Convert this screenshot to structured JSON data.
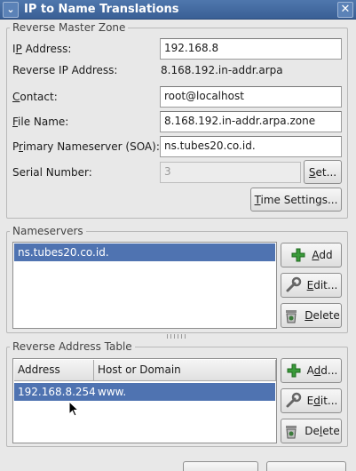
{
  "window": {
    "title": "IP to Name Translations"
  },
  "reverse_master_zone": {
    "group_label": "Reverse Master Zone",
    "ip_address_label_pre": "I",
    "ip_address_label_mnemonic": "P",
    "ip_address_label_post": " Address:",
    "ip_address_value": "192.168.8",
    "reverse_ip_label": "Reverse IP Address:",
    "reverse_ip_value": "8.168.192.in-addr.arpa",
    "contact_label_mnemonic": "C",
    "contact_label_post": "ontact:",
    "contact_value": "root@localhost",
    "filename_label_mnemonic": "F",
    "filename_label_post": "ile Name:",
    "filename_value": "8.168.192.in-addr.arpa.zone",
    "primary_ns_label_pre": "P",
    "primary_ns_label_mnemonic": "r",
    "primary_ns_label_post": "imary Nameserver (SOA):",
    "primary_ns_value": "ns.tubes20.co.id.",
    "serial_label": "Serial Number:",
    "serial_value": "3",
    "set_button_mnemonic": "S",
    "set_button_post": "et...",
    "time_settings_mnemonic": "T",
    "time_settings_post": "ime Settings..."
  },
  "nameservers": {
    "group_label": "Nameservers",
    "items": [
      "ns.tubes20.co.id."
    ],
    "add_mnemonic": "A",
    "add_post": "dd",
    "edit_mnemonic": "E",
    "edit_post": "dit...",
    "delete_mnemonic": "D",
    "delete_post": "elete"
  },
  "reverse_address_table": {
    "group_label": "Reverse Address Table",
    "columns": [
      "Address",
      "Host or Domain"
    ],
    "rows": [
      {
        "address": "192.168.8.254",
        "host": "www."
      }
    ],
    "add_pre": "A",
    "add_mnemonic": "d",
    "add_post": "d...",
    "edit_pre": "E",
    "edit_mnemonic": "d",
    "edit_post": "it...",
    "delete_pre": "De",
    "delete_mnemonic": "l",
    "delete_post": "ete"
  },
  "colors": {
    "titlebar": "#3a5f95",
    "selection": "#4f73b1",
    "background": "#e8e8e8"
  },
  "icons": [
    "window-menu-icon",
    "close-icon",
    "add-icon",
    "edit-wrench-icon",
    "delete-trash-icon",
    "mouse-pointer-icon"
  ]
}
